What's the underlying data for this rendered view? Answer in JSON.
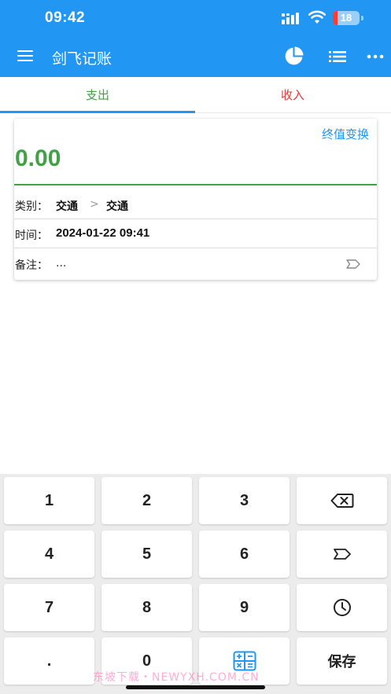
{
  "status_bar": {
    "time": "09:42",
    "battery_level": "18"
  },
  "app_bar": {
    "title": "剑飞记账",
    "icons": [
      "menu-icon",
      "pie-chart-icon",
      "list-icon",
      "more-icon"
    ]
  },
  "tabs": [
    {
      "label": "支出",
      "selected": true
    },
    {
      "label": "收入",
      "selected": false
    }
  ],
  "entry": {
    "convert_link": "终值变换",
    "amount": "0.00",
    "category_label": "类别：",
    "category_parent": "交通",
    "category_separator": ">",
    "category_child": "交通",
    "time_label": "时间：",
    "time_value": "2024-01-22 09:41",
    "note_label": "备注：",
    "note_placeholder": "..."
  },
  "keypad": {
    "keys": [
      "1",
      "2",
      "3",
      "4",
      "5",
      "6",
      "7",
      "8",
      "9",
      ".",
      "0"
    ],
    "icons": [
      "backspace-icon",
      "tag-icon",
      "clock-icon",
      "calculator-icon"
    ],
    "save_label": "保存"
  },
  "watermark": "东坡下载・NEWYXH.COM.CN",
  "colors": {
    "primary": "#2196F3",
    "expense": "#43A047",
    "income": "#E53935"
  }
}
